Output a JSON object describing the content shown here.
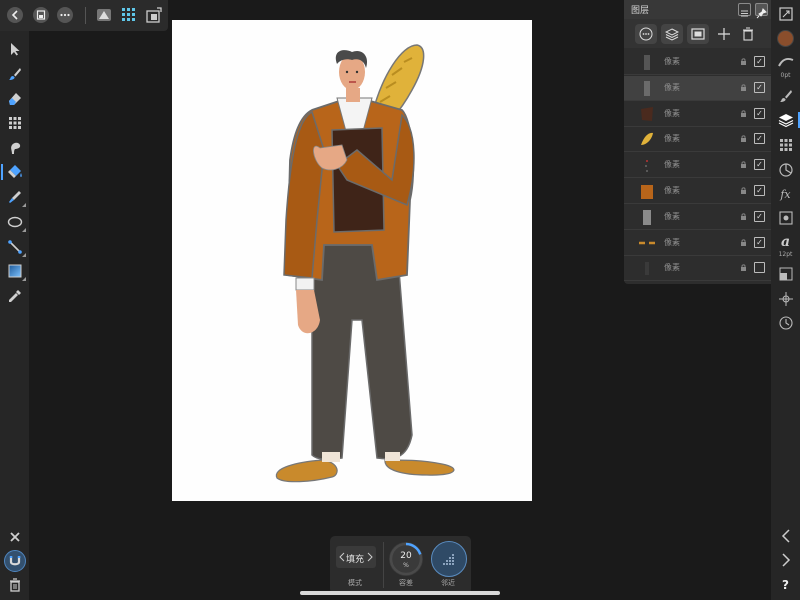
{
  "toolbar": {
    "items": [
      "back-icon",
      "save-icon",
      "more-icon",
      "persona-pixel-icon",
      "grid-icon",
      "export-icon"
    ]
  },
  "left_tools": [
    "move-tool",
    "paint-brush-tool",
    "erase-brush-tool",
    "selection-brush-tool",
    "smudge-tool",
    "flood-fill-tool",
    "color-picker-tool",
    "ellipse-tool",
    "line-tool",
    "gradient-tool",
    "eyedropper-tool"
  ],
  "left_bottom": [
    "close-icon",
    "magnet-icon",
    "trash-icon"
  ],
  "layers_panel": {
    "title": "图层",
    "rows": [
      {
        "name": "像素",
        "visible": true,
        "selected": false
      },
      {
        "name": "像素",
        "visible": true,
        "selected": true
      },
      {
        "name": "像素",
        "visible": true,
        "selected": false
      },
      {
        "name": "像素",
        "visible": true,
        "selected": false
      },
      {
        "name": "像素",
        "visible": true,
        "selected": false
      },
      {
        "name": "像素",
        "visible": true,
        "selected": false
      },
      {
        "name": "像素",
        "visible": true,
        "selected": false
      },
      {
        "name": "像素",
        "visible": true,
        "selected": false
      },
      {
        "name": "像素",
        "visible": false,
        "selected": false
      }
    ]
  },
  "right_column": {
    "brush_size_label": "0pt",
    "text_size_label": "12pt",
    "fx_label": "fx",
    "text_glyph": "a",
    "help_label": "?",
    "color_swatch": "#8a4e2c"
  },
  "context_toolbar": {
    "mode_value": "填充",
    "mode_label": "模式",
    "tolerance_value": "20",
    "tolerance_unit": "%",
    "tolerance_label": "容差",
    "contiguous_label": "邻近"
  },
  "colors": {
    "accent": "#4fa3ff",
    "jacket": "#b8651a",
    "pants": "#4e4a45",
    "bread": "#e0b23a",
    "shoes": "#c98a2c"
  }
}
